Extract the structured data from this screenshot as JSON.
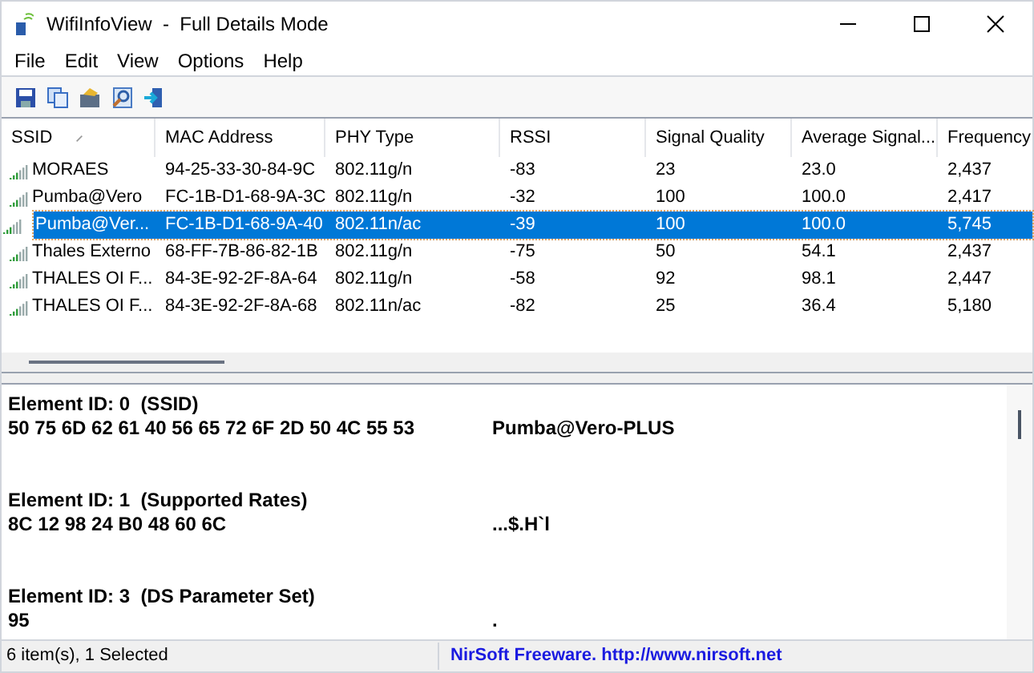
{
  "window": {
    "title": "WifiInfoView  -  Full Details Mode"
  },
  "menu": [
    "File",
    "Edit",
    "View",
    "Options",
    "Help"
  ],
  "table": {
    "columns": [
      "SSID",
      "MAC Address",
      "PHY Type",
      "RSSI",
      "Signal Quality",
      "Average Signal...",
      "Frequency"
    ],
    "rows": [
      {
        "selected": false,
        "cells": [
          "MORAES",
          "94-25-33-30-84-9C",
          "802.11g/n",
          "-83",
          "23",
          "23.0",
          "2,437"
        ]
      },
      {
        "selected": false,
        "cells": [
          "Pumba@Vero",
          "FC-1B-D1-68-9A-3C",
          "802.11g/n",
          "-32",
          "100",
          "100.0",
          "2,417"
        ]
      },
      {
        "selected": true,
        "cells": [
          "Pumba@Ver...",
          "FC-1B-D1-68-9A-40",
          "802.11n/ac",
          "-39",
          "100",
          "100.0",
          "5,745"
        ]
      },
      {
        "selected": false,
        "cells": [
          "Thales Externo",
          "68-FF-7B-86-82-1B",
          "802.11g/n",
          "-75",
          "50",
          "54.1",
          "2,437"
        ]
      },
      {
        "selected": false,
        "cells": [
          "THALES OI F...",
          "84-3E-92-2F-8A-64",
          "802.11g/n",
          "-58",
          "92",
          "98.1",
          "2,447"
        ]
      },
      {
        "selected": false,
        "cells": [
          "THALES OI F...",
          "84-3E-92-2F-8A-68",
          "802.11n/ac",
          "-82",
          "25",
          "36.4",
          "5,180"
        ]
      }
    ]
  },
  "details": [
    {
      "heading": "Element ID: 0  (SSID)",
      "hex": "50 75 6D 62 61 40 56 65 72 6F 2D 50 4C 55 53",
      "ascii": "Pumba@Vero-PLUS"
    },
    {
      "heading": "Element ID: 1  (Supported Rates)",
      "hex": "8C 12 98 24 B0 48 60 6C",
      "ascii": "...$.H`l"
    },
    {
      "heading": "Element ID: 3  (DS Parameter Set)",
      "hex": "95",
      "ascii": "."
    }
  ],
  "status_bar": {
    "items": "6 item(s), 1 Selected",
    "credit": "NirSoft Freeware.  http://www.nirsoft.net"
  }
}
